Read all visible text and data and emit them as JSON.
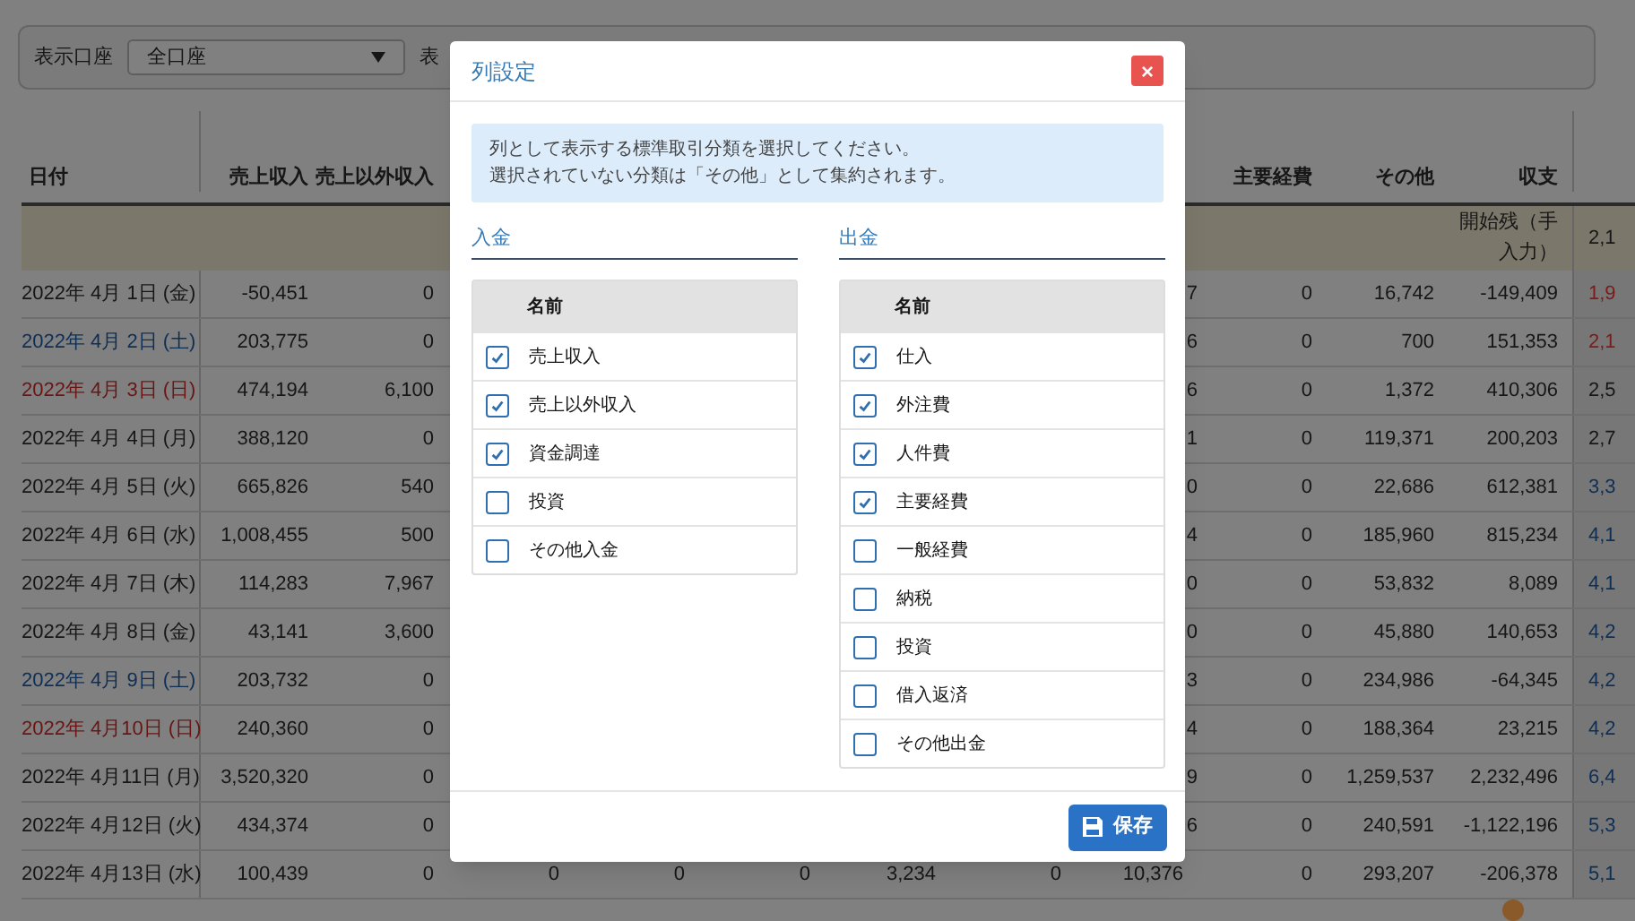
{
  "filter_bar": {
    "account_label": "表示口座",
    "account_select": "全口座",
    "display_label": "表"
  },
  "table": {
    "columns": [
      "日付",
      "売上収入",
      "売上以外収入",
      "主要経費",
      "その他",
      "収支"
    ],
    "opening_row": {
      "label": "開始残（手入力）",
      "balance": "2,1"
    },
    "rows": [
      {
        "date": "2022年 4月 1日 (金)",
        "kind": "weekday",
        "c1": "-50,451",
        "c2": "0",
        "middle": [
          "7"
        ],
        "c10": "0",
        "c11": "16,742",
        "c12": "-149,409",
        "last": {
          "text": "1,9",
          "color": "#7a1c1a"
        }
      },
      {
        "date": "2022年 4月 2日 (土)",
        "kind": "saturday",
        "c1": "203,775",
        "c2": "0",
        "middle": [
          "6"
        ],
        "c10": "0",
        "c11": "700",
        "c12": "151,353",
        "last": {
          "text": "2,1",
          "color": "#7a1c1a"
        }
      },
      {
        "date": "2022年 4月 3日 (日)",
        "kind": "sunday",
        "c1": "474,194",
        "c2": "6,100",
        "middle": [
          "6"
        ],
        "c10": "0",
        "c11": "1,372",
        "c12": "410,306",
        "last": {
          "text": "2,5",
          "color": "#161616"
        }
      },
      {
        "date": "2022年 4月 4日 (月)",
        "kind": "weekday",
        "c1": "388,120",
        "c2": "0",
        "middle": [
          "1"
        ],
        "c10": "0",
        "c11": "119,371",
        "c12": "200,203",
        "last": {
          "text": "2,7",
          "color": "#161616"
        }
      },
      {
        "date": "2022年 4月 5日 (火)",
        "kind": "weekday",
        "c1": "665,826",
        "c2": "540",
        "middle": [
          "0"
        ],
        "c10": "0",
        "c11": "22,686",
        "c12": "612,381",
        "last": {
          "text": "3,3",
          "color": "#0e2f55"
        }
      },
      {
        "date": "2022年 4月 6日 (水)",
        "kind": "weekday",
        "c1": "1,008,455",
        "c2": "500",
        "middle": [
          "4"
        ],
        "c10": "0",
        "c11": "185,960",
        "c12": "815,234",
        "last": {
          "text": "4,1",
          "color": "#0e2f55"
        }
      },
      {
        "date": "2022年 4月 7日 (木)",
        "kind": "weekday",
        "c1": "114,283",
        "c2": "7,967",
        "middle": [
          "0"
        ],
        "c10": "0",
        "c11": "53,832",
        "c12": "8,089",
        "last": {
          "text": "4,1",
          "color": "#0e2f55"
        }
      },
      {
        "date": "2022年 4月 8日 (金)",
        "kind": "weekday",
        "c1": "43,141",
        "c2": "3,600",
        "middle": [
          "0"
        ],
        "c10": "0",
        "c11": "45,880",
        "c12": "140,653",
        "last": {
          "text": "4,2",
          "color": "#0e2f55"
        }
      },
      {
        "date": "2022年 4月 9日 (土)",
        "kind": "saturday",
        "c1": "203,732",
        "c2": "0",
        "middle": [
          "3"
        ],
        "c10": "0",
        "c11": "234,986",
        "c12": "-64,345",
        "last": {
          "text": "4,2",
          "color": "#0e2f55"
        }
      },
      {
        "date": "2022年 4月10日 (日)",
        "kind": "sunday",
        "c1": "240,360",
        "c2": "0",
        "middle": [
          "4"
        ],
        "c10": "0",
        "c11": "188,364",
        "c12": "23,215",
        "last": {
          "text": "4,2",
          "color": "#0e2f55"
        }
      },
      {
        "date": "2022年 4月11日 (月)",
        "kind": "weekday",
        "c1": "3,520,320",
        "c2": "0",
        "middle": [
          "9"
        ],
        "c10": "0",
        "c11": "1,259,537",
        "c12": "2,232,496",
        "last": {
          "text": "6,4",
          "color": "#0e2f55"
        }
      },
      {
        "date": "2022年 4月12日 (火)",
        "kind": "weekday",
        "c1": "434,374",
        "c2": "0",
        "middle": [
          "6"
        ],
        "c10": "0",
        "c11": "240,591",
        "c12": "-1,122,196",
        "last": {
          "text": "5,3",
          "color": "#0e2f55"
        }
      },
      {
        "date": "2022年 4月13日 (水)",
        "kind": "weekday",
        "c1": "100,439",
        "c2": "0",
        "middle": [
          "0",
          "0",
          "0",
          "3,234",
          "0",
          "10,376"
        ],
        "c10": "0",
        "c11": "293,207",
        "c12": "-206,378",
        "last": {
          "text": "5,1",
          "color": "#0e2f55"
        }
      }
    ]
  },
  "dialog": {
    "title": "列設定",
    "close": "×",
    "info": [
      "列として表示する標準取引分類を選択してください。",
      "選択されていない分類は「その他」として集約されます。"
    ],
    "sections": [
      {
        "heading": "入金",
        "column": "名前",
        "items": [
          {
            "label": "売上収入",
            "checked": true
          },
          {
            "label": "売上以外収入",
            "checked": true
          },
          {
            "label": "資金調達",
            "checked": true
          },
          {
            "label": "投資",
            "checked": false
          },
          {
            "label": "その他入金",
            "checked": false
          }
        ]
      },
      {
        "heading": "出金",
        "column": "名前",
        "items": [
          {
            "label": "仕入",
            "checked": true
          },
          {
            "label": "外注費",
            "checked": true
          },
          {
            "label": "人件費",
            "checked": true
          },
          {
            "label": "主要経費",
            "checked": true
          },
          {
            "label": "一般経費",
            "checked": false
          },
          {
            "label": "納税",
            "checked": false
          },
          {
            "label": "投資",
            "checked": false
          },
          {
            "label": "借入返済",
            "checked": false
          },
          {
            "label": "その他出金",
            "checked": false
          }
        ]
      }
    ],
    "save": "保存"
  }
}
